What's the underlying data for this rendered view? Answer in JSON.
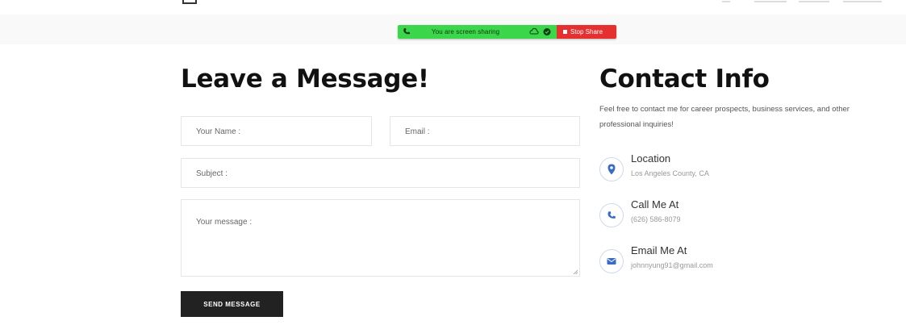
{
  "screen_share": {
    "message": "You are screen sharing",
    "stop_label": "Stop Share",
    "icons": [
      "phone-icon",
      "cloud-icon",
      "shield-icon",
      "stop-icon"
    ],
    "colors": {
      "bar": "#3cd64b",
      "stop": "#e53030"
    }
  },
  "form": {
    "title": "Leave a Message!",
    "name_placeholder": "Your Name :",
    "email_placeholder": "Email :",
    "subject_placeholder": "Subject :",
    "message_placeholder": "Your message :",
    "submit_label": "SEND MESSAGE"
  },
  "contact": {
    "title": "Contact Info",
    "description": "Feel free to contact me for career prospects, business services, and other professional inquiries!",
    "items": [
      {
        "label": "Location",
        "value": "Los Angeles County, CA",
        "icon": "location-pin-icon"
      },
      {
        "label": "Call Me At",
        "value": "(626) 586-8079",
        "icon": "phone-icon"
      },
      {
        "label": "Email Me At",
        "value": "johnnyung91@gmail.com",
        "icon": "envelope-icon"
      }
    ],
    "icon_color": "#3a6bc4"
  }
}
